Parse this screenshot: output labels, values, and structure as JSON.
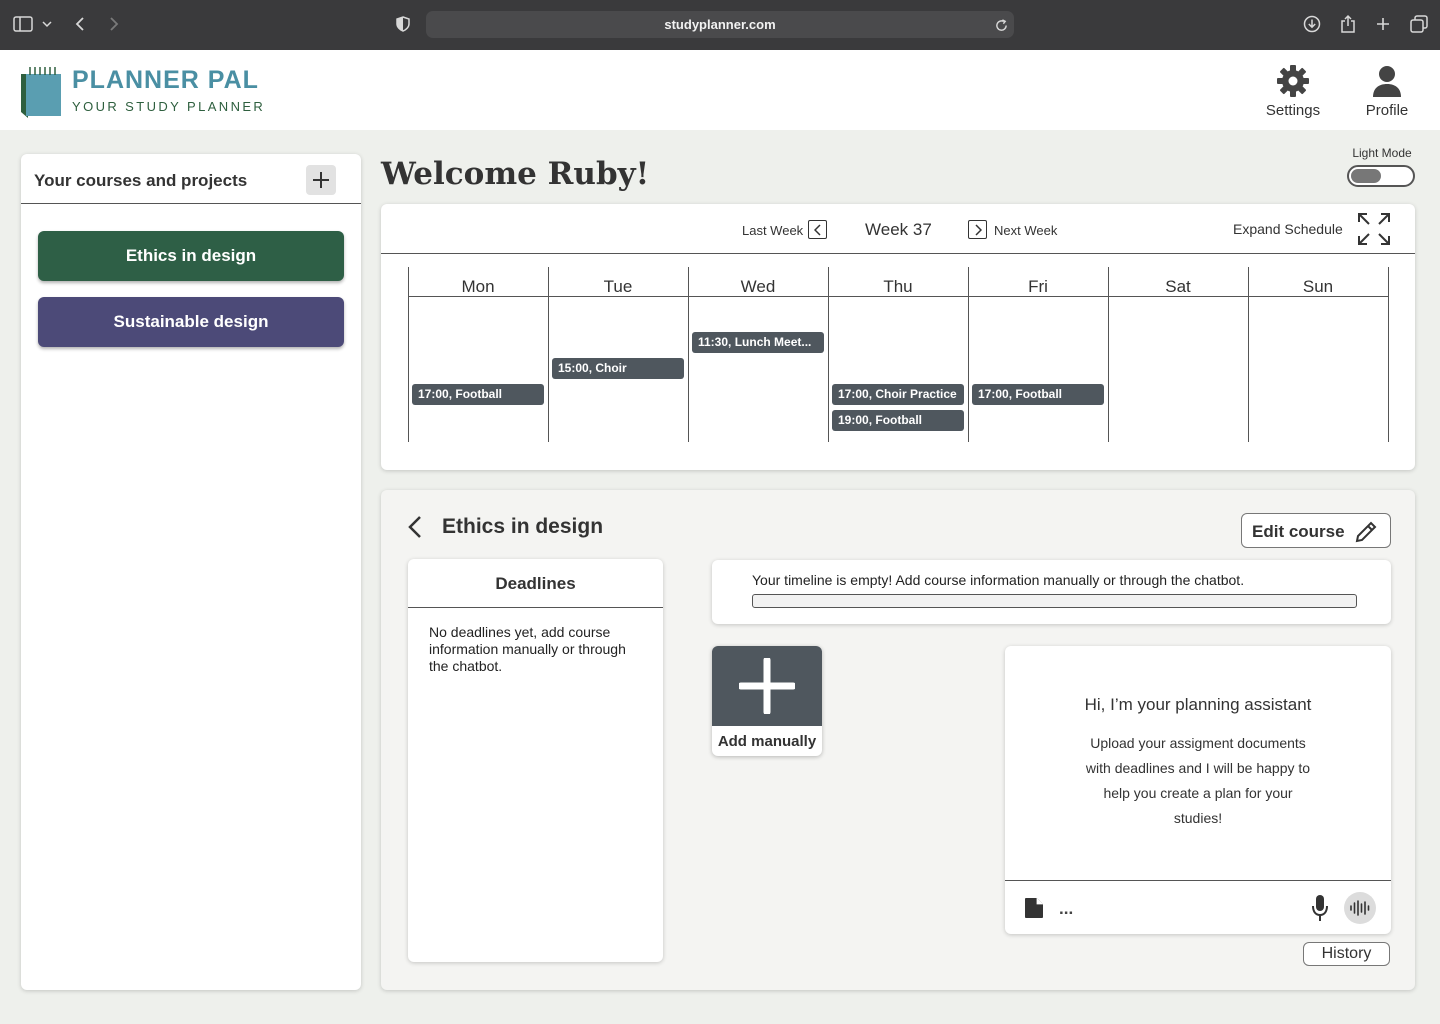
{
  "browser": {
    "url": "studyplanner.com"
  },
  "brand": {
    "name": "PLANNER PAL",
    "tagline": "YOUR STUDY PLANNER",
    "color": "#4a8fa3"
  },
  "header": {
    "settings_label": "Settings",
    "profile_label": "Profile"
  },
  "sidebar": {
    "title": "Your courses and projects",
    "courses": [
      {
        "label": "Ethics in design",
        "color": "#2e5f46"
      },
      {
        "label": "Sustainable design",
        "color": "#4c4a78"
      }
    ]
  },
  "welcome": "Welcome Ruby!",
  "light_mode": {
    "label": "Light Mode",
    "on": false
  },
  "schedule": {
    "last_week_label": "Last Week",
    "week_label": "Week 37",
    "next_week_label": "Next Week",
    "expand_label": "Expand Schedule",
    "days": [
      "Mon",
      "Tue",
      "Wed",
      "Thu",
      "Fri",
      "Sat",
      "Sun"
    ],
    "events": [
      {
        "day": "Mon",
        "label": "17:00, Football"
      },
      {
        "day": "Tue",
        "label": "15:00, Choir"
      },
      {
        "day": "Wed",
        "label": "11:30, Lunch Meet..."
      },
      {
        "day": "Thu",
        "label": "17:00, Choir Practice"
      },
      {
        "day": "Thu",
        "label": "19:00, Football"
      },
      {
        "day": "Fri",
        "label": "17:00, Football"
      }
    ]
  },
  "course": {
    "title": "Ethics in design",
    "edit_label": "Edit course",
    "deadlines": {
      "title": "Deadlines",
      "empty_text": "No deadlines yet, add course information manually or through the chatbot."
    },
    "timeline": {
      "empty_text": "Your timeline is empty! Add course information manually or through the chatbot."
    },
    "add_manually_label": "Add manually",
    "assistant": {
      "title": "Hi, I’m your planning assistant",
      "body": "Upload your assigment documents with deadlines and I will be happy to help you create a plan for your studies!",
      "input_placeholder": "..."
    },
    "history_label": "History"
  }
}
